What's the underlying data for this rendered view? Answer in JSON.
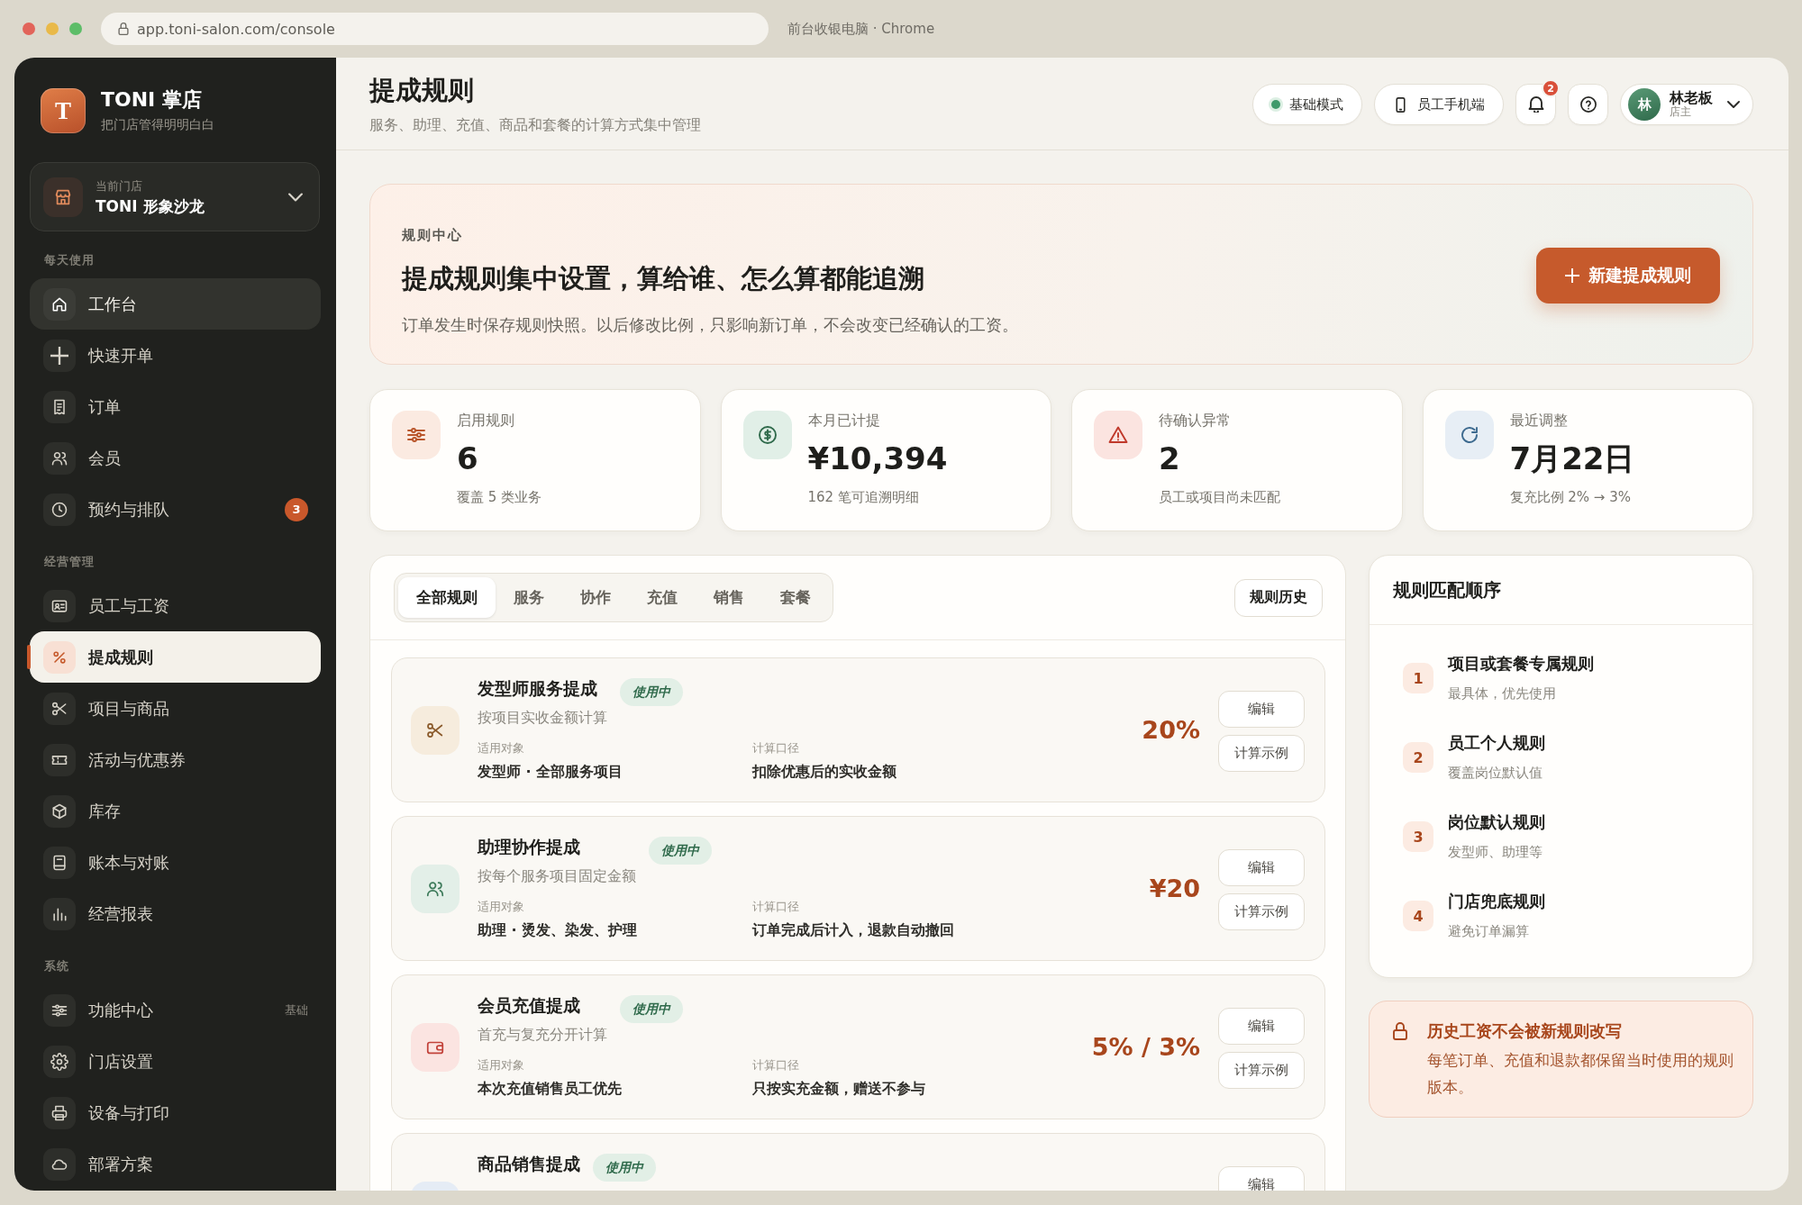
{
  "browser": {
    "url": "app.toni-salon.com/console",
    "window_title": "前台收银电脑 · Chrome"
  },
  "sidebar": {
    "logo": "T",
    "app_name": "TONI 掌店",
    "tagline": "把门店管得明明白白",
    "store": {
      "label": "当前门店",
      "name": "TONI 形象沙龙"
    },
    "sections": [
      {
        "title": "每天使用",
        "items": [
          {
            "label": "工作台",
            "selected": false,
            "highlighted": true
          },
          {
            "label": "快速开单",
            "selected": false,
            "highlighted": false
          },
          {
            "label": "订单",
            "selected": false,
            "highlighted": false
          },
          {
            "label": "会员",
            "selected": false,
            "highlighted": false
          },
          {
            "label": "预约与排队",
            "selected": false,
            "highlighted": false,
            "badge": "3"
          }
        ]
      },
      {
        "title": "经营管理",
        "items": [
          {
            "label": "员工与工资",
            "selected": false,
            "highlighted": false
          },
          {
            "label": "提成规则",
            "selected": true,
            "highlighted": false
          },
          {
            "label": "项目与商品",
            "selected": false,
            "highlighted": false
          },
          {
            "label": "活动与优惠券",
            "selected": false,
            "highlighted": false
          },
          {
            "label": "库存",
            "selected": false,
            "highlighted": false
          },
          {
            "label": "账本与对账",
            "selected": false,
            "highlighted": false
          },
          {
            "label": "经营报表",
            "selected": false,
            "highlighted": false
          }
        ]
      },
      {
        "title": "系统",
        "items": [
          {
            "label": "功能中心",
            "selected": false,
            "highlighted": false,
            "tag": "基础"
          },
          {
            "label": "门店设置",
            "selected": false,
            "highlighted": false
          },
          {
            "label": "设备与打印",
            "selected": false,
            "highlighted": false
          },
          {
            "label": "部署方案",
            "selected": false,
            "highlighted": false
          }
        ]
      }
    ]
  },
  "header": {
    "title": "提成规则",
    "subtitle": "服务、助理、充值、商品和套餐的计算方式集中管理",
    "mode": "基础模式",
    "mobile": "员工手机端",
    "notification_count": "2",
    "user": {
      "avatar": "林",
      "name": "林老板",
      "role": "店主"
    }
  },
  "hero": {
    "eyebrow": "规则中心",
    "title": "提成规则集中设置，算给谁、怎么算都能追溯",
    "description": "订单发生时保存规则快照。以后修改比例，只影响新订单，不会改变已经确认的工资。",
    "button": "新建提成规则"
  },
  "stats": [
    {
      "label": "启用规则",
      "value": "6",
      "note": "覆盖 5 类业务"
    },
    {
      "label": "本月已计提",
      "value": "¥10,394",
      "note": "162 笔可追溯明细"
    },
    {
      "label": "待确认异常",
      "value": "2",
      "note": "员工或项目尚未匹配"
    },
    {
      "label": "最近调整",
      "value": "7月22日",
      "note": "复充比例 2% → 3%"
    }
  ],
  "rules_panel": {
    "tabs": [
      {
        "label": "全部规则",
        "selected": true
      },
      {
        "label": "服务",
        "selected": false
      },
      {
        "label": "协作",
        "selected": false
      },
      {
        "label": "充值",
        "selected": false
      },
      {
        "label": "销售",
        "selected": false
      },
      {
        "label": "套餐",
        "selected": false
      }
    ],
    "history_button": "规则历史",
    "rules": [
      {
        "title": "发型师服务提成",
        "status": "使用中",
        "description": "按项目实收金额计算",
        "fields": [
          {
            "label": "适用对象",
            "value": "发型师 · 全部服务项目"
          },
          {
            "label": "计算口径",
            "value": "扣除优惠后的实收金额"
          }
        ],
        "amount": "20%",
        "actions": [
          "编辑",
          "计算示例"
        ]
      },
      {
        "title": "助理协作提成",
        "status": "使用中",
        "description": "按每个服务项目固定金额",
        "fields": [
          {
            "label": "适用对象",
            "value": "助理 · 烫发、染发、护理"
          },
          {
            "label": "计算口径",
            "value": "订单完成后计入，退款自动撤回"
          }
        ],
        "amount": "¥20",
        "actions": [
          "编辑",
          "计算示例"
        ]
      },
      {
        "title": "会员充值提成",
        "status": "使用中",
        "description": "首充与复充分开计算",
        "fields": [
          {
            "label": "适用对象",
            "value": "本次充值销售员工优先"
          },
          {
            "label": "计算口径",
            "value": "只按实充金额，赠送不参与"
          }
        ],
        "amount": "5% / 3%",
        "actions": [
          "编辑",
          "计算示例"
        ]
      },
      {
        "title": "商品销售提成",
        "status": "使用中",
        "actions": [
          "编辑"
        ]
      }
    ]
  },
  "match_order": {
    "title": "规则匹配顺序",
    "steps": [
      {
        "number": "1",
        "title": "项目或套餐专属规则",
        "note": "最具体，优先使用"
      },
      {
        "number": "2",
        "title": "员工个人规则",
        "note": "覆盖岗位默认值"
      },
      {
        "number": "3",
        "title": "岗位默认规则",
        "note": "发型师、助理等"
      },
      {
        "number": "4",
        "title": "门店兜底规则",
        "note": "避免订单漏算"
      }
    ]
  },
  "notice": {
    "title": "历史工资不会被新规则改写",
    "body": "每笔订单、充值和退款都保留当时使用的规则版本。"
  }
}
